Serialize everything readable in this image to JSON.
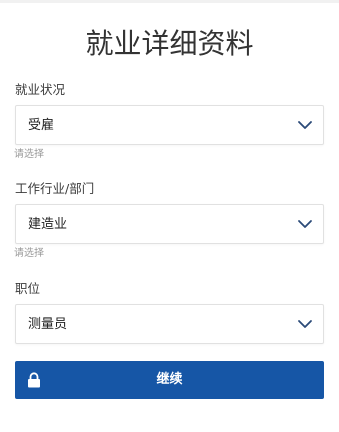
{
  "page": {
    "title": "就业详细资料"
  },
  "form": {
    "employment_status": {
      "label": "就业状况",
      "value": "受雇",
      "hint": "请选择"
    },
    "industry": {
      "label": "工作行业/部门",
      "value": "建造业",
      "hint": "请选择"
    },
    "position": {
      "label": "职位",
      "value": "测量员"
    }
  },
  "continue_button": {
    "label": "继续",
    "icon": "lock-icon"
  },
  "colors": {
    "accent": "#1656a6",
    "chevron": "#2b4a78",
    "hint": "#9a9a9a",
    "border": "#e1e1e1"
  }
}
